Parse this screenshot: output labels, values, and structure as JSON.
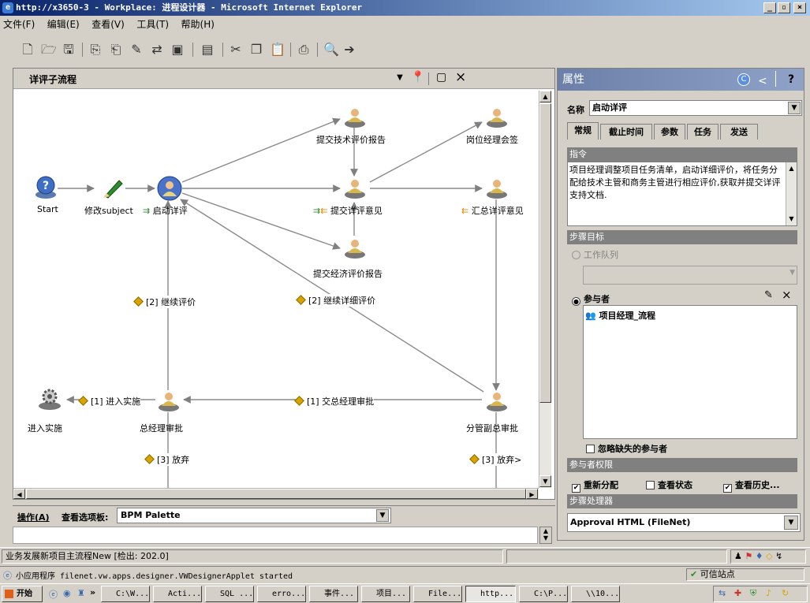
{
  "window": {
    "title": "http://x3650-3 - Workplace: 进程设计器 - Microsoft Internet Explorer",
    "min": "_",
    "max": "▫",
    "close": "×"
  },
  "menu": [
    "文件(F)",
    "编辑(E)",
    "查看(V)",
    "工具(T)",
    "帮助(H)"
  ],
  "editor": {
    "workflow_name": "详评子流程",
    "close_glyph": "×"
  },
  "nodes": {
    "start": "Start",
    "modify": "修改subject",
    "initiate": "启动详评",
    "tech_report": "提交技术评价报告",
    "post_manager": "岗位经理会签",
    "submit_detail": "提交详评意见",
    "summary": "汇总详评意见",
    "econ_report": "提交经济评价报告",
    "implement": "进入实施",
    "gm_approve": "总经理审批",
    "vp_approve": "分管副总审批"
  },
  "transitions": {
    "continue_review": "[2] 继续评价",
    "continue_detail": "[2] 继续详细评价",
    "to_gm": "[1] 交总经理审批",
    "enter_impl": "[1] 进入实施",
    "abandon_left": "[3] 放弃",
    "abandon_right": "[3] 放弃>"
  },
  "ops": {
    "operation": "操作(A)",
    "palette_label": "查看选项板:",
    "palette_value": "BPM Palette"
  },
  "properties": {
    "header": "属性",
    "help": "?",
    "name_label": "名称",
    "name_value": "启动详评",
    "tabs": [
      "常规",
      "截止时间",
      "参数",
      "任务",
      "发送"
    ],
    "instruction_header": "指令",
    "instruction_text": "项目经理调整项目任务清单，启动详细评价，将任务分配给技术主管和商务主管进行相应评价,获取并提交详评支持文档.",
    "step_target_header": "步骤目标",
    "work_queue": "工作队列",
    "participants": "参与者",
    "participant_item": "项目经理_流程",
    "ignore_missing": "忽略缺失的参与者",
    "rights_header": "参与者权限",
    "rights": [
      {
        "label": "重新分配",
        "checked": true
      },
      {
        "label": "查看状态",
        "checked": false
      },
      {
        "label": "查看历史...",
        "checked": true
      }
    ],
    "processor_header": "步骤处理器",
    "processor_value": "Approval HTML (FileNet)"
  },
  "status": {
    "left": "业务发展新项目主流程New [检出: 202.0]"
  },
  "ie_status": {
    "text": "小应用程序 filenet.vw.apps.designer.VWDesignerApplet started",
    "zone": "可信站点"
  },
  "taskbar": {
    "start": "开始",
    "tasks": [
      "C:\\W...",
      "Acti...",
      "SQL ...",
      "erro...",
      "事件...",
      "项目...",
      "File...",
      "http...",
      "C:\\P...",
      "\\\\10..."
    ]
  },
  "colors": {
    "title_start": "#0a246a",
    "node_diamond": "#d9a400",
    "arrow": "#808080"
  }
}
